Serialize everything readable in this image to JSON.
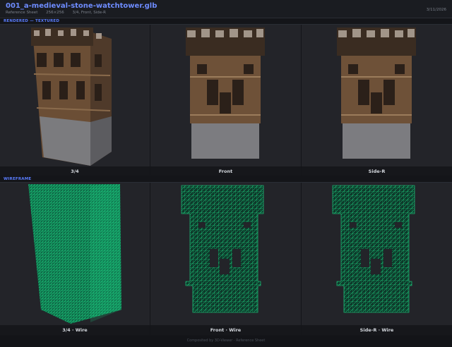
{
  "header": {
    "title": "001_a-medieval-stone-watchtower.glb",
    "subtitle": [
      "Reference Sheet",
      "256×256",
      "3/4, Front, Side-R"
    ],
    "date": "3/11/2026"
  },
  "sections": {
    "rendered": "RENDERED — TEXTURED",
    "wireframe": "WIREFRAME"
  },
  "rendered_views": [
    "3/4",
    "Front",
    "Side-R"
  ],
  "wire_views": [
    "3/4  ·  Wire",
    "Front  ·  Wire",
    "Side-R  ·  Wire"
  ],
  "footer": "Composited by 3D-Viewer · Reference Sheet",
  "colors": {
    "accent": "#5a7dff",
    "wire": "#1fe08a",
    "panel": "#232429",
    "stone": "#7d7d80",
    "wood": "#6b4e35"
  }
}
